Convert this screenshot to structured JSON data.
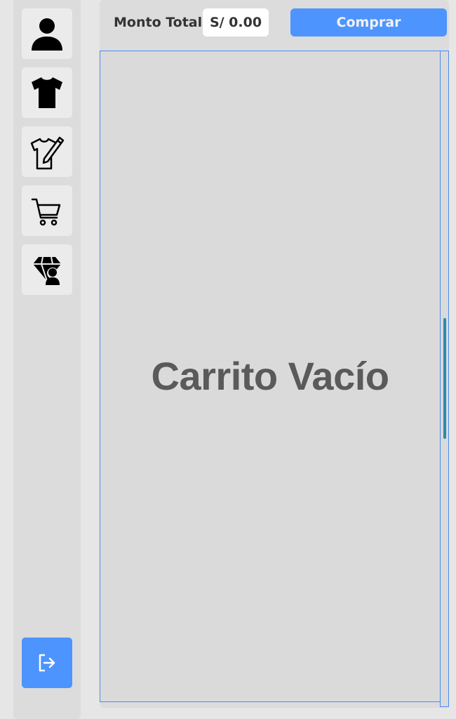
{
  "sidebar": {
    "items": [
      {
        "icon": "user-icon"
      },
      {
        "icon": "tshirt-icon"
      },
      {
        "icon": "tshirt-design-icon"
      },
      {
        "icon": "cart-icon"
      },
      {
        "icon": "admin-gem-icon"
      }
    ],
    "logout_icon": "logout-icon"
  },
  "header": {
    "total_label": "Monto Total",
    "total_value": "S/ 0.00",
    "buy_label": "Comprar"
  },
  "cart": {
    "empty_message": "Carrito Vacío"
  },
  "colors": {
    "accent": "#4d94ff",
    "scrollbar": "#2e8ba6",
    "text": "#333333"
  }
}
